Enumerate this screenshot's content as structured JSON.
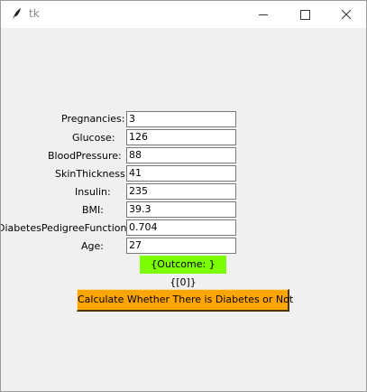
{
  "window": {
    "title": "tk",
    "icon": "feather-icon",
    "controls": [
      "minimize-icon",
      "maximize-icon",
      "close-icon"
    ]
  },
  "form": {
    "fields": [
      {
        "label": "Pregnancies:",
        "value": "3"
      },
      {
        "label": "Glucose:",
        "value": "126"
      },
      {
        "label": "BloodPressure:",
        "value": "88"
      },
      {
        "label": "SkinThickness:",
        "value": "41"
      },
      {
        "label": "Insulin:",
        "value": "235"
      },
      {
        "label": "BMI:",
        "value": "39.3"
      },
      {
        "label": "DiabetesPedigreeFunction:",
        "value": "0.704"
      },
      {
        "label": "Age:",
        "value": "27"
      }
    ]
  },
  "result": {
    "text": "{Outcome: } {[0]}",
    "color": "#7cfc00"
  },
  "action": {
    "label": "Calculate Whether There is Diabetes or Not",
    "color": "#ffa500"
  }
}
